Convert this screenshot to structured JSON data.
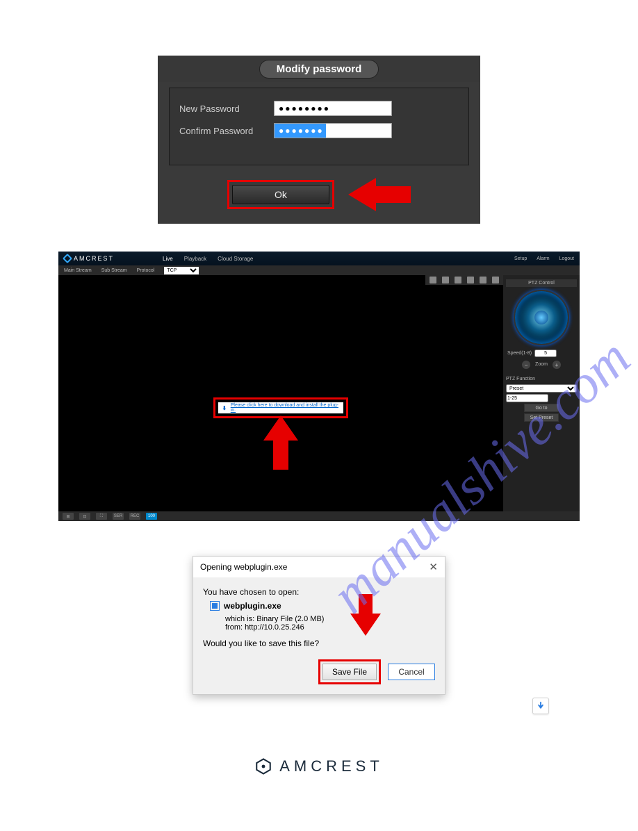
{
  "modify_password": {
    "title": "Modify password",
    "new_label": "New Password",
    "confirm_label": "Confirm Password",
    "new_value": "●●●●●●●●",
    "confirm_value": "●●●●●●●",
    "ok_label": "Ok"
  },
  "web_ui": {
    "brand": "AMCREST",
    "nav": {
      "live": "Live",
      "playback": "Playback",
      "cloud": "Cloud Storage"
    },
    "right": {
      "setup": "Setup",
      "alarm": "Alarm",
      "logout": "Logout"
    },
    "sub": {
      "main": "Main Stream",
      "sub_s": "Sub Stream",
      "proto": "Protocol",
      "proto_val": "TCP"
    },
    "download_link": "Please click here to download and install the plug-in.",
    "ptz": {
      "title": "PTZ Control",
      "speed_label": "Speed(1-8)",
      "speed_val": "5",
      "zoom": "Zoom",
      "func_title": "PTZ Function",
      "preset": "Preset",
      "num": "1-25",
      "goto": "Go to",
      "setpreset": "Set Preset"
    },
    "bottom": {
      "a": "⊞",
      "b": "⊡",
      "c": "⛶",
      "d": "SER",
      "e": "REC",
      "f": "100"
    }
  },
  "download_dialog": {
    "title": "Opening webplugin.exe",
    "chosen": "You have chosen to open:",
    "filename": "webplugin.exe",
    "which_is_label": "which is:",
    "which_is": "Binary File (2.0 MB)",
    "from_label": "from:",
    "from": "http://10.0.25.246",
    "question": "Would you like to save this file?",
    "save": "Save File",
    "cancel": "Cancel"
  },
  "footer": {
    "brand": "AMCREST"
  }
}
